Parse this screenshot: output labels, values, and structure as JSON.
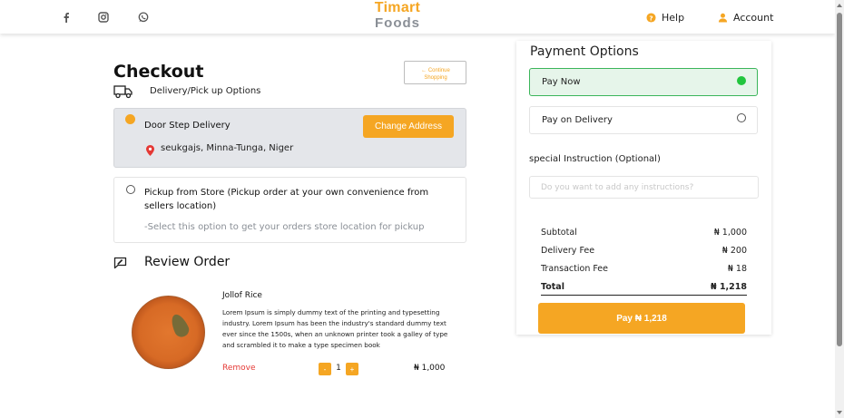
{
  "header": {
    "brand_top": "Timart",
    "brand_bottom": "Foods",
    "help_label": "Help",
    "account_label": "Account",
    "social_icons": [
      "facebook-icon",
      "instagram-icon",
      "whatsapp-icon"
    ]
  },
  "checkout": {
    "title": "Checkout",
    "continue_label": "← Continue Shopping",
    "delivery_options_label": "Delivery/Pick up Options",
    "doorstep": {
      "title": "Door Step Delivery",
      "change_address_label": "Change Address",
      "address": "seukgajs, Minna-Tunga, Niger",
      "selected": true
    },
    "pickup": {
      "title": "Pickup from Store (Pickup order at your own convenience from sellers location)",
      "note": "-Select this option to get your orders store location for pickup",
      "selected": false
    }
  },
  "review": {
    "title": "Review Order",
    "items": [
      {
        "name": "Jollof Rice",
        "description": "Lorem Ipsum is simply dummy text of the printing and typesetting industry. Lorem Ipsum has been the industry's standard dummy text ever since the 1500s, when an unknown printer took a galley of type and scrambled it to make a type specimen book",
        "remove_label": "Remove",
        "minus_label": "-",
        "quantity": "1",
        "plus_label": "+",
        "price": "₦ 1,000"
      }
    ]
  },
  "payment": {
    "title": "Payment Options",
    "options": [
      {
        "label": "Pay Now",
        "selected": true
      },
      {
        "label": "Pay on Delivery",
        "selected": false
      }
    ],
    "instruction_label": "special Instruction (Optional)",
    "instruction_placeholder": "Do you want to add any instructions?",
    "instruction_value": ""
  },
  "summary": {
    "subtotal_label": "Subtotal",
    "subtotal_value": "₦ 1,000",
    "delivery_label": "Delivery Fee",
    "delivery_value": "₦ 200",
    "transaction_label": "Transaction Fee",
    "transaction_value": "₦ 18",
    "total_label": "Total",
    "total_value": "₦ 1,218",
    "pay_button_label": "Pay ₦ 1,218"
  },
  "colors": {
    "accent": "#f5a623",
    "success": "#22c53e",
    "danger": "#e53935"
  }
}
